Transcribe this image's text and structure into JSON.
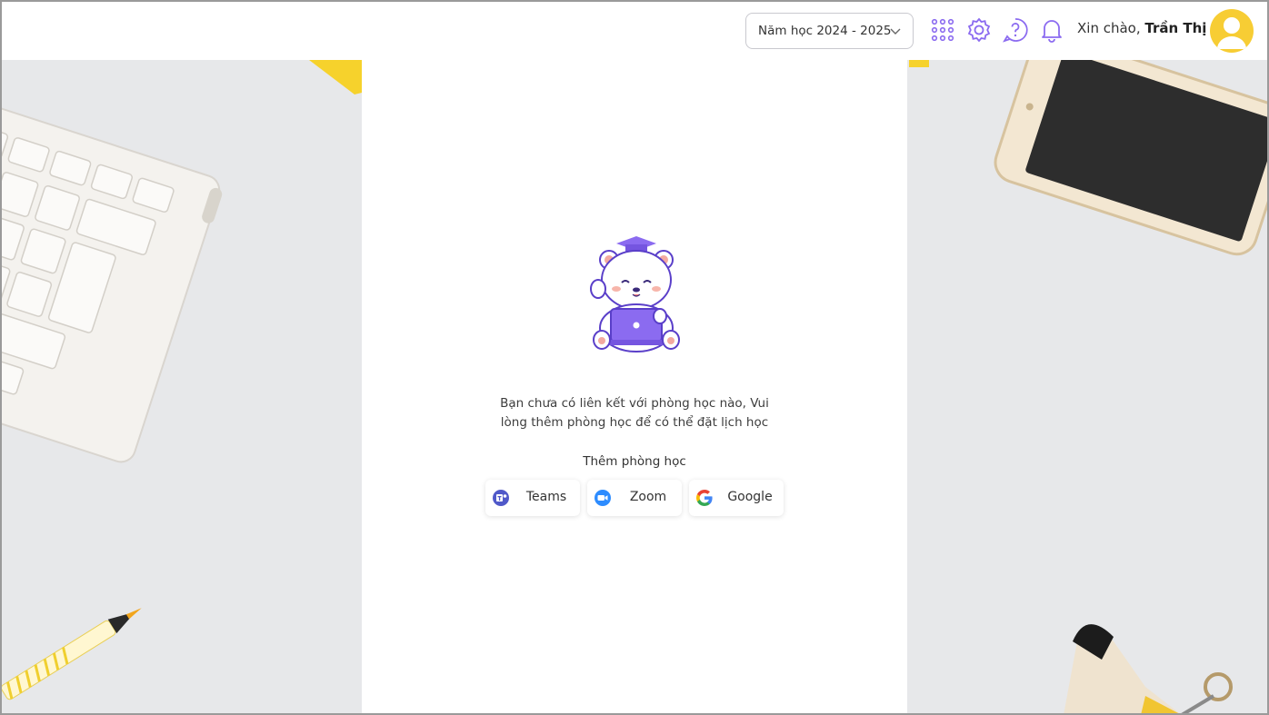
{
  "header": {
    "year_select": "Năm học 2024 - 2025",
    "greeting_prefix": "Xin chào,",
    "user_name": "Trần Thị"
  },
  "empty_state": {
    "message": "Bạn chưa có liên kết với phòng học nào, Vui lòng thêm phòng học để có thể đặt lịch học",
    "add_title": "Thêm phòng học"
  },
  "providers": [
    {
      "label": "Teams",
      "icon": "teams-icon"
    },
    {
      "label": "Zoom",
      "icon": "zoom-icon"
    },
    {
      "label": "Google",
      "icon": "google-icon"
    }
  ],
  "colors": {
    "accent": "#8b6bf0",
    "avatar_bg": "#f7cd34",
    "teams": "#5059c9",
    "zoom": "#2d8cff"
  }
}
